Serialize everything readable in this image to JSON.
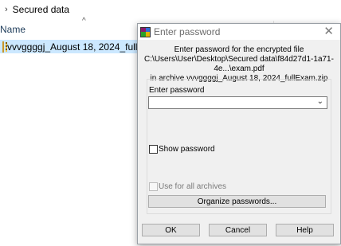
{
  "explorer": {
    "breadcrumb": "Secured data",
    "name_column": "Name",
    "file_name": "vvvggggj_August 18, 2024_fullExam.zip"
  },
  "dialog": {
    "title": "Enter password",
    "message_line1": "Enter password for the encrypted file",
    "message_line2": "C:\\Users\\User\\Desktop\\Secured data\\f84d27d1-1a71-4e...\\exam.pdf",
    "message_line3": "in archive vvvggggj_August 18, 2024_fullExam.zip",
    "password_label": "Enter password",
    "password_value": "",
    "show_password_label": "Show password",
    "show_password_checked": false,
    "use_for_all_label": "Use for all archives",
    "use_for_all_checked": false,
    "organize_button": "Organize passwords...",
    "ok_button": "OK",
    "cancel_button": "Cancel",
    "help_button": "Help"
  },
  "icons": {
    "close": "close-icon",
    "chevron": "chevron-right-icon",
    "sort": "sort-up-icon",
    "dropdown": "chevron-down-icon",
    "archive": "zip-archive-icon",
    "app": "winrar-icon"
  }
}
